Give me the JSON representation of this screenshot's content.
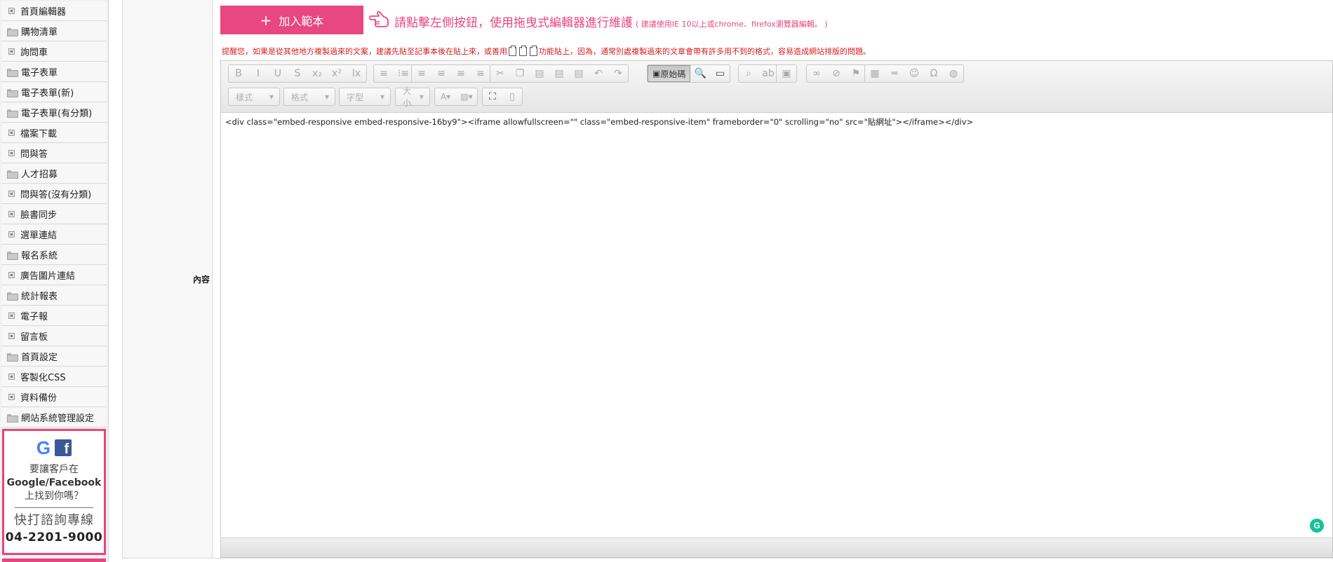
{
  "sidebar": {
    "items": [
      {
        "label": "首頁編輯器",
        "icon": "box"
      },
      {
        "label": "購物清單",
        "icon": "folder"
      },
      {
        "label": "詢問車",
        "icon": "box"
      },
      {
        "label": "電子表單",
        "icon": "folder"
      },
      {
        "label": "電子表單(新)",
        "icon": "folder"
      },
      {
        "label": "電子表單(有分類)",
        "icon": "folder"
      },
      {
        "label": "檔案下載",
        "icon": "box"
      },
      {
        "label": "問與答",
        "icon": "box"
      },
      {
        "label": "人才招募",
        "icon": "folder"
      },
      {
        "label": "問與答(沒有分類)",
        "icon": "box"
      },
      {
        "label": "臉書同步",
        "icon": "box"
      },
      {
        "label": "選單連結",
        "icon": "box"
      },
      {
        "label": "報名系統",
        "icon": "folder"
      },
      {
        "label": "廣告圖片連結",
        "icon": "box"
      },
      {
        "label": "統計報表",
        "icon": "folder"
      },
      {
        "label": "電子報",
        "icon": "box"
      },
      {
        "label": "留言板",
        "icon": "box"
      },
      {
        "label": "首頁設定",
        "icon": "folder"
      },
      {
        "label": "客製化CSS",
        "icon": "box"
      },
      {
        "label": "資料備份",
        "icon": "box"
      },
      {
        "label": "網站系統管理設定",
        "icon": "folder"
      }
    ],
    "promo": {
      "line1": "要讓客戶在",
      "line2": "Google/Facebook",
      "line3": "上找到你嗎？",
      "line4": "快打諮詢專線",
      "phone": "04-2201-9000",
      "google_letter": "G",
      "facebook_letter": "f",
      "accent": "#e6457f"
    }
  },
  "form": {
    "content_label": "內容"
  },
  "header": {
    "template_button": "加入範本",
    "template_plus": "+",
    "instruction": "請點擊左側按鈕，使用拖曳式編輯器進行維護",
    "instruction_note": "( 建議使用IE 10以上或chrome、firefox瀏覽器編輯。 )",
    "accent": "#e8477f"
  },
  "warning": {
    "part1": "提醒您，如果是從其他地方複製過來的文案，建議先貼至記事本後在貼上來，或善用",
    "part2": "功能貼上，因為，通常別處複製過來的文章會帶有許多用不到的格式，容易造成網站排版的問題。",
    "color": "#d41e1e"
  },
  "toolbar": {
    "row1": [
      {
        "group": "basic",
        "buttons": [
          {
            "name": "bold-icon",
            "glyph": "B"
          },
          {
            "name": "italic-icon",
            "glyph": "I"
          },
          {
            "name": "underline-icon",
            "glyph": "U"
          },
          {
            "name": "strike-icon",
            "glyph": "S"
          },
          {
            "name": "subscript-icon",
            "glyph": "x₂"
          },
          {
            "name": "superscript-icon",
            "glyph": "x²"
          },
          {
            "name": "remove-format-icon",
            "glyph": "Ix"
          }
        ]
      },
      {
        "group": "list",
        "buttons": [
          {
            "name": "numbered-list-icon",
            "glyph": "≡"
          },
          {
            "name": "bulleted-list-icon",
            "glyph": "⁝≡"
          }
        ]
      },
      {
        "group": "align",
        "buttons": [
          {
            "name": "align-left-icon",
            "glyph": "≡"
          },
          {
            "name": "align-center-icon",
            "glyph": "≡"
          },
          {
            "name": "align-right-icon",
            "glyph": "≡"
          },
          {
            "name": "align-justify-icon",
            "glyph": "≡"
          }
        ]
      },
      {
        "group": "clipboard",
        "buttons": [
          {
            "name": "cut-icon",
            "glyph": "✂"
          },
          {
            "name": "copy-icon",
            "glyph": "❐"
          },
          {
            "name": "paste-icon",
            "glyph": "▤"
          },
          {
            "name": "paste-text-icon",
            "glyph": "▤"
          },
          {
            "name": "paste-word-icon",
            "glyph": "▤"
          },
          {
            "name": "undo-icon",
            "glyph": "↶"
          },
          {
            "name": "redo-icon",
            "glyph": "↷"
          }
        ]
      },
      {
        "group": "source",
        "source_label": "原始碼",
        "buttons": [
          {
            "name": "preview-icon",
            "glyph": "🔍"
          },
          {
            "name": "templates-icon",
            "glyph": "▭"
          }
        ]
      },
      {
        "group": "find",
        "buttons": [
          {
            "name": "find-icon",
            "glyph": "⌕"
          },
          {
            "name": "replace-icon",
            "glyph": "ab"
          }
        ]
      },
      {
        "group": "image",
        "buttons": [
          {
            "name": "image-icon",
            "glyph": "▣"
          }
        ]
      },
      {
        "group": "links",
        "buttons": [
          {
            "name": "link-icon",
            "glyph": "∞"
          },
          {
            "name": "unlink-icon",
            "glyph": "⊘"
          },
          {
            "name": "anchor-icon",
            "glyph": "⚑"
          }
        ]
      },
      {
        "group": "insert",
        "buttons": [
          {
            "name": "table-icon",
            "glyph": "▦"
          },
          {
            "name": "horizontal-rule-icon",
            "glyph": "═"
          },
          {
            "name": "smiley-icon",
            "glyph": "☺"
          },
          {
            "name": "special-char-icon",
            "glyph": "Ω"
          },
          {
            "name": "iframe-icon",
            "glyph": "◍"
          }
        ]
      }
    ],
    "combos": {
      "style": "樣式",
      "format": "格式",
      "font": "字型",
      "size": "大小"
    }
  },
  "editor": {
    "source_code": "<div class=\"embed-responsive embed-responsive-16by9\"><iframe allowfullscreen=\"\" class=\"embed-responsive-item\" frameborder=\"0\" scrolling=\"no\" src=\"貼網址\"></iframe></div>"
  },
  "grammarly": {
    "glyph": "G",
    "color": "#15c39a"
  }
}
